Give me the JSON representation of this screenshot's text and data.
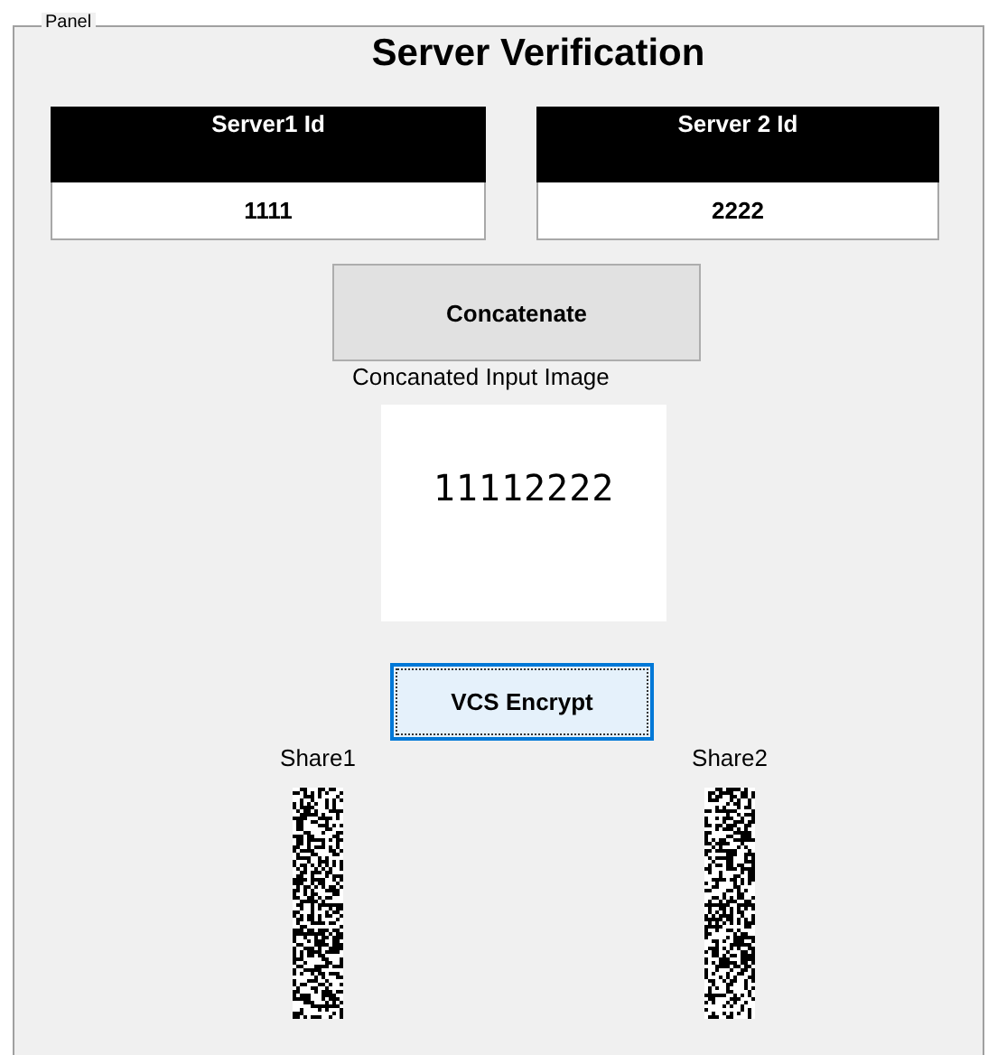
{
  "panel": {
    "label": "Panel"
  },
  "title": "Server Verification",
  "servers": [
    {
      "heading": "Server1 Id",
      "value": "1111"
    },
    {
      "heading": "Server 2 Id",
      "value": "2222"
    }
  ],
  "concatenate_button": "Concatenate",
  "image_caption": "Concanated Input Image",
  "image_text": "11112222",
  "encrypt_button": {
    "label": "VCS Encrypt",
    "focused": true
  },
  "shares": [
    {
      "label": "Share1"
    },
    {
      "label": "Share2"
    }
  ]
}
